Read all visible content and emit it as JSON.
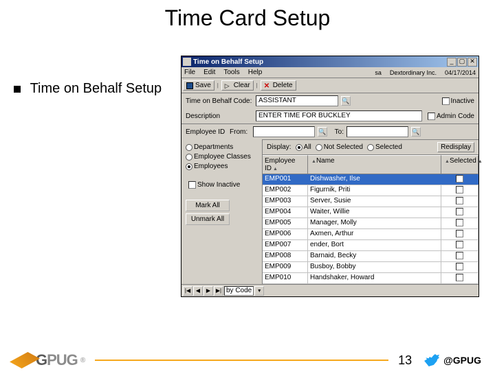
{
  "slide": {
    "title": "Time Card Setup",
    "bullet": "Time on Behalf Setup",
    "page": "13"
  },
  "footer": {
    "logo": "GPUG",
    "handle": "@GPUG"
  },
  "win": {
    "title": "Time on Behalf Setup",
    "menus": [
      "File",
      "Edit",
      "Tools",
      "Help"
    ],
    "status_user": "sa",
    "status_co": "Dextordinary Inc.",
    "status_date": "04/17/2014",
    "toolbar": {
      "save": "Save",
      "clear": "Clear",
      "delete": "Delete"
    },
    "form": {
      "code_lbl": "Time on Behalf Code:",
      "code_val": "ASSISTANT",
      "desc_lbl": "Description",
      "desc_val": "ENTER TIME FOR BUCKLEY",
      "inactive": "Inactive",
      "admin": "Admin Code",
      "empid_lbl": "Employee ID",
      "from_lbl": "From:",
      "to_lbl": "To:"
    },
    "filter": {
      "display": "Display:",
      "all": "All",
      "notsel": "Not Selected",
      "sel": "Selected",
      "redisplay": "Redisplay"
    },
    "left": {
      "dept": "Departments",
      "cls": "Employee Classes",
      "emp": "Employees",
      "show": "Show Inactive",
      "mark": "Mark All",
      "unmark": "Unmark All"
    },
    "grid": {
      "h_emp": "Employee ID",
      "h_name": "Name",
      "h_sel": "Selected",
      "rows": [
        {
          "id": "EMP001",
          "name": "Dishwasher, Ilse"
        },
        {
          "id": "EMP002",
          "name": "Figurnik, Priti"
        },
        {
          "id": "EMP003",
          "name": "Server, Susie"
        },
        {
          "id": "EMP004",
          "name": "Waiter, Willie"
        },
        {
          "id": "EMP005",
          "name": "Manager, Molly"
        },
        {
          "id": "EMP006",
          "name": "Axmen, Arthur"
        },
        {
          "id": "EMP007",
          "name": "ender, Bort"
        },
        {
          "id": "EMP008",
          "name": "Barnaid, Becky"
        },
        {
          "id": "EMP009",
          "name": "Busboy, Bobby"
        },
        {
          "id": "EMP010",
          "name": "Handshaker, Howard"
        }
      ]
    },
    "nav": {
      "sort": "by Code"
    }
  }
}
